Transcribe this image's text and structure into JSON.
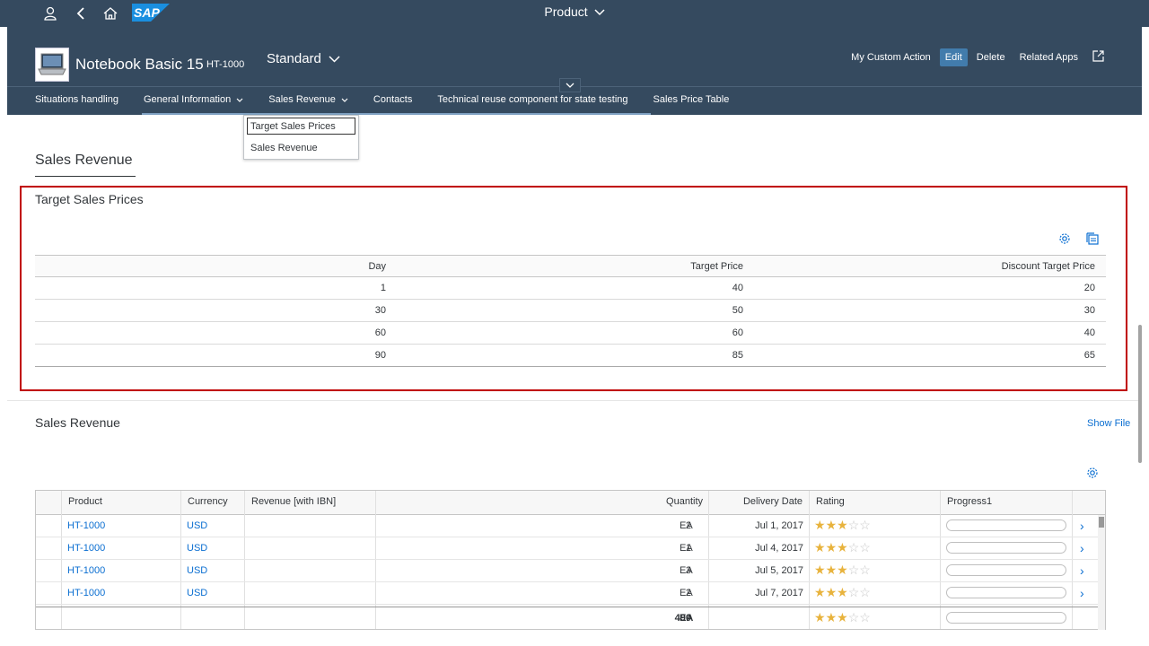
{
  "shell": {
    "title": "Product",
    "logo_text": "SAP",
    "icons": [
      "user-icon",
      "back-icon",
      "home-icon"
    ]
  },
  "header": {
    "title": "Notebook Basic 15",
    "product_id": "HT-1000",
    "variant": "Standard",
    "actions": {
      "custom": "My Custom Action",
      "edit": "Edit",
      "delete": "Delete",
      "related": "Related Apps"
    }
  },
  "anchor_bar": {
    "items": [
      "Situations handling",
      "General Information",
      "Sales Revenue",
      "Contacts",
      "Technical reuse component for state testing",
      "Sales Price Table"
    ]
  },
  "popover": {
    "items": [
      "Target Sales Prices",
      "Sales Revenue"
    ]
  },
  "section": {
    "title": "Sales Revenue"
  },
  "target_prices": {
    "title": "Target Sales Prices",
    "headers": [
      "Day",
      "Target Price",
      "Discount Target Price"
    ],
    "rows": [
      [
        "1",
        "40",
        "20"
      ],
      [
        "30",
        "50",
        "30"
      ],
      [
        "60",
        "60",
        "40"
      ],
      [
        "90",
        "85",
        "65"
      ]
    ]
  },
  "sales_revenue": {
    "title": "Sales Revenue",
    "show_file": "Show File",
    "headers": [
      "Product",
      "Currency",
      "Revenue [with IBN]",
      "Quantity",
      "Delivery Date",
      "Rating",
      "Progress1"
    ],
    "rows": [
      {
        "product": "HT-1000",
        "currency": "USD",
        "quantity": "2",
        "unit": "EA",
        "date": "Jul 1, 2017",
        "rating": 3,
        "progress": 0
      },
      {
        "product": "HT-1000",
        "currency": "USD",
        "quantity": "1",
        "unit": "EA",
        "date": "Jul 4, 2017",
        "rating": 3,
        "progress": 0
      },
      {
        "product": "HT-1000",
        "currency": "USD",
        "quantity": "3",
        "unit": "EA",
        "date": "Jul 5, 2017",
        "rating": 3,
        "progress": 0
      },
      {
        "product": "HT-1000",
        "currency": "USD",
        "quantity": "2",
        "unit": "EA",
        "date": "Jul 7, 2017",
        "rating": 3,
        "progress": 0
      }
    ],
    "total": {
      "quantity": "490",
      "unit": "EA",
      "rating": 3,
      "progress": 0
    }
  },
  "colors": {
    "shell_bg": "#354a5f",
    "accent": "#0a6ed1",
    "highlight": "#c00000",
    "star": "#e8b33d"
  }
}
